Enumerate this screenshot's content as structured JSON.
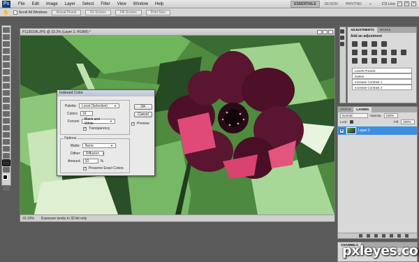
{
  "app": {
    "logo": "Ps"
  },
  "menu": [
    "File",
    "Edit",
    "Image",
    "Layer",
    "Select",
    "Filter",
    "View",
    "Window",
    "Help"
  ],
  "workspaces": {
    "essentials": "ESSENTIALS",
    "design": "DESIGN",
    "painting": "PAINTING",
    "more": "»"
  },
  "cs_live": "CS Live",
  "options_bar": {
    "scroll_all": "Scroll All Windows",
    "actual_pixels": "Actual Pixels",
    "fit_screen": "Fit Screen",
    "fill_screen": "Fill Screen",
    "print_size": "Print Size"
  },
  "document": {
    "title": "P1130196.JPG @ 33.3% (Layer 2, RGB/8) *",
    "zoom": "33.33%",
    "status": "Exposure works in 32-bit only"
  },
  "dialog": {
    "title": "Indexed Color",
    "palette_label": "Palette:",
    "palette_value": "Local (Selective)",
    "colors_label": "Colors:",
    "colors_value": "16",
    "forced_label": "Forced:",
    "forced_value": "Black and White",
    "transparency": "Transparency",
    "options_label": "Options",
    "matte_label": "Matte:",
    "matte_value": "None",
    "dither_label": "Dither:",
    "dither_value": "Diffusion",
    "amount_label": "Amount:",
    "amount_value": "10",
    "amount_unit": "%",
    "preserve": "Preserve Exact Colors",
    "ok": "OK",
    "cancel": "Cancel",
    "preview": "Preview"
  },
  "adjustments": {
    "tab1": "ADJUSTMENTS",
    "tab2": "MASKS",
    "title": "Add an adjustment",
    "presets": [
      "Levels Presets",
      "Darker",
      "Increase Contrast 1",
      "Increase Contrast 2"
    ]
  },
  "layers": {
    "tab_paths": "PATHS",
    "tab_layers": "LAYERS",
    "blend": "Normal",
    "opacity_label": "Opacity:",
    "opacity_value": "100%",
    "lock_label": "Lock:",
    "fill_label": "Fill:",
    "fill_value": "100%",
    "layer_name": "Layer 2"
  },
  "channels": {
    "tab": "CHANNELS"
  },
  "watermark": "pxleyes.com",
  "colors": {
    "accent": "#3d8fe0",
    "flower": "#5a1530",
    "petal_pink": "#e04a78"
  }
}
